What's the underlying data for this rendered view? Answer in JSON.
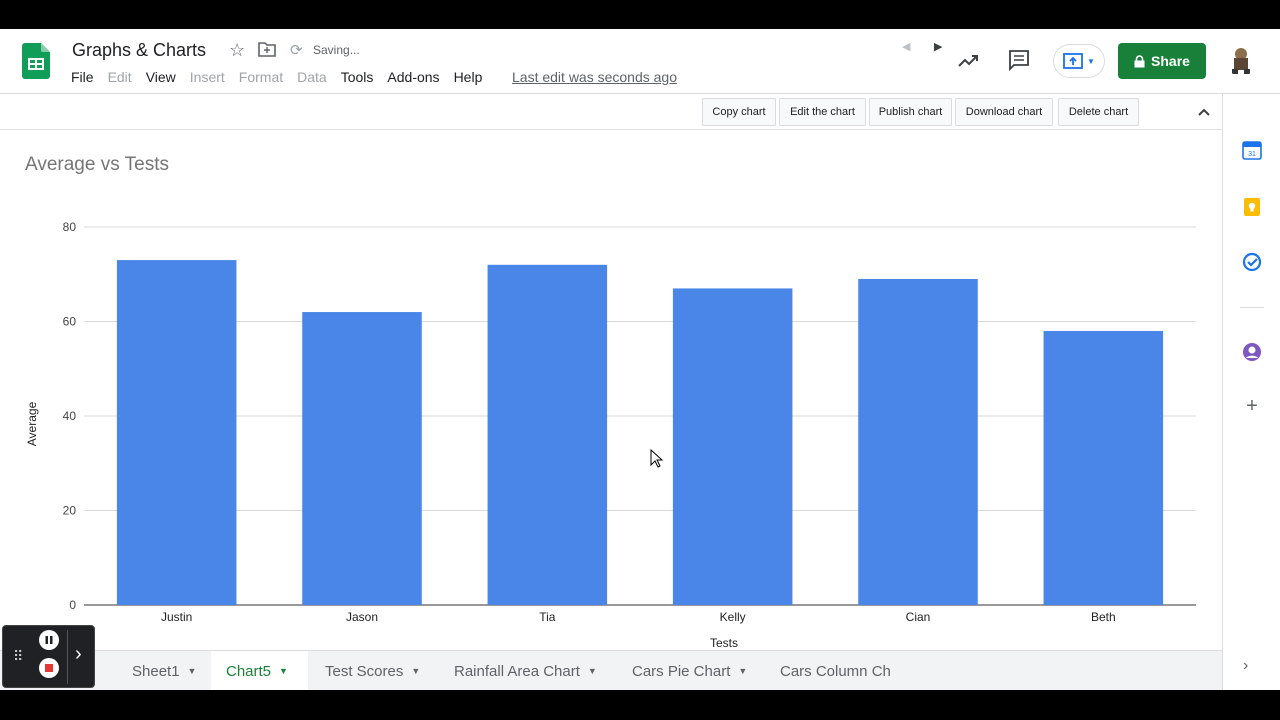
{
  "header": {
    "doc_title": "Graphs & Charts",
    "saving_status": "Saving...",
    "last_edit": "Last edit was seconds ago",
    "share_label": "Share",
    "menu": [
      {
        "label": "File",
        "disabled": false
      },
      {
        "label": "Edit",
        "disabled": true
      },
      {
        "label": "View",
        "disabled": false
      },
      {
        "label": "Insert",
        "disabled": true
      },
      {
        "label": "Format",
        "disabled": true
      },
      {
        "label": "Data",
        "disabled": true
      },
      {
        "label": "Tools",
        "disabled": false
      },
      {
        "label": "Add-ons",
        "disabled": false
      },
      {
        "label": "Help",
        "disabled": false
      }
    ]
  },
  "chart_toolbar": {
    "copy": "Copy chart",
    "edit": "Edit the chart",
    "publish": "Publish chart",
    "download": "Download chart",
    "delete": "Delete chart"
  },
  "chart_data": {
    "type": "bar",
    "title": "Average vs Tests",
    "xlabel": "Tests",
    "ylabel": "Average",
    "categories": [
      "Justin",
      "Jason",
      "Tia",
      "Kelly",
      "Cian",
      "Beth"
    ],
    "values": [
      73,
      62,
      72,
      67,
      69,
      58
    ],
    "ylim": [
      0,
      80
    ],
    "yticks": [
      0,
      20,
      40,
      60,
      80
    ],
    "grid": true,
    "color": "#4a86e8"
  },
  "tabs": [
    {
      "label": "Sheet1",
      "active": false
    },
    {
      "label": "Chart5",
      "active": true
    },
    {
      "label": "Test Scores",
      "active": false
    },
    {
      "label": "Rainfall Area Chart",
      "active": false
    },
    {
      "label": "Cars Pie Chart",
      "active": false
    },
    {
      "label": "Cars Column Ch",
      "active": false
    }
  ],
  "colors": {
    "brand_green": "#188038",
    "bar_blue": "#4a86e8"
  },
  "icons": [
    "sheets-logo-icon",
    "star-icon",
    "folder-icon",
    "sync-icon",
    "trend-icon",
    "comment-icon",
    "present-icon",
    "lock-icon",
    "calendar-icon",
    "keep-icon",
    "tasks-icon",
    "contacts-icon",
    "plus-icon"
  ]
}
